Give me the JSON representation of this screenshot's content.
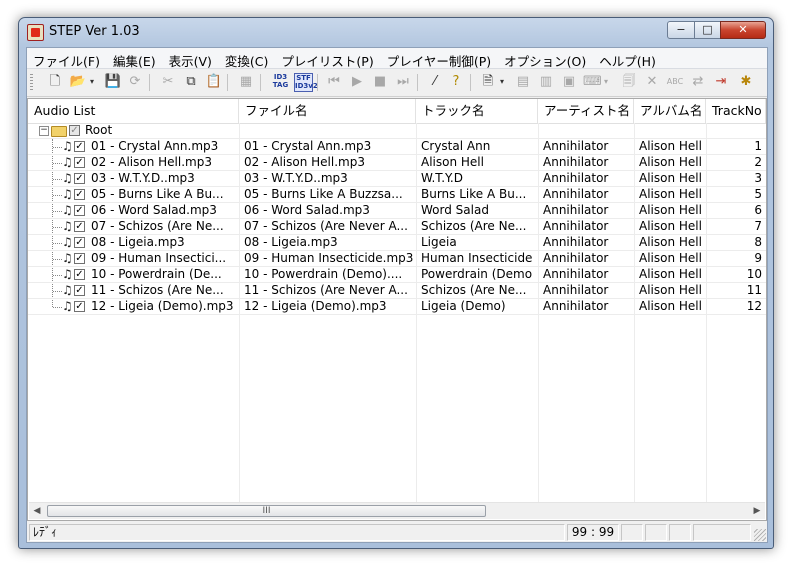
{
  "window": {
    "title": "STEP Ver 1.03",
    "caption": {
      "minimize": "−",
      "maximize": "□",
      "close": "✕"
    }
  },
  "menu": [
    "ファイル(F)",
    "編集(E)",
    "表示(V)",
    "変換(C)",
    "プレイリスト(P)",
    "プレイヤー制御(P)",
    "オプション(O)",
    "ヘルプ(H)"
  ],
  "toolbar": {
    "new_icon": "new-file-icon",
    "open_icon": "open-folder-icon",
    "save_icon": "save-icon",
    "id3_tag_label_top": "ID3",
    "id3_tag_label_bottom": "TAG",
    "stf_label_top": "STF",
    "stf_label_bottom": "ID3v2"
  },
  "columns": [
    "Audio List",
    "ファイル名",
    "トラック名",
    "アーティスト名",
    "アルバム名",
    "TrackNo"
  ],
  "root": {
    "label": "Root"
  },
  "rows": [
    {
      "audio": "01 - Crystal Ann.mp3",
      "file": "01 - Crystal Ann.mp3",
      "track": "Crystal Ann",
      "artist": "Annihilator",
      "album": "Alison Hell",
      "no": "1"
    },
    {
      "audio": "02 - Alison Hell.mp3",
      "file": "02 - Alison Hell.mp3",
      "track": "Alison Hell",
      "artist": "Annihilator",
      "album": "Alison Hell",
      "no": "2"
    },
    {
      "audio": "03 - W.T.Y.D..mp3",
      "file": "03 - W.T.Y.D..mp3",
      "track": "W.T.Y.D",
      "artist": "Annihilator",
      "album": "Alison Hell",
      "no": "3"
    },
    {
      "audio": "05 - Burns Like A Bu...",
      "file": "05 - Burns Like A Buzzsa...",
      "track": "Burns Like A Bu...",
      "artist": "Annihilator",
      "album": "Alison Hell",
      "no": "5"
    },
    {
      "audio": "06 - Word Salad.mp3",
      "file": "06 - Word Salad.mp3",
      "track": "Word Salad",
      "artist": "Annihilator",
      "album": "Alison Hell",
      "no": "6"
    },
    {
      "audio": "07 - Schizos (Are Ne...",
      "file": "07 - Schizos (Are Never A...",
      "track": "Schizos (Are Ne...",
      "artist": "Annihilator",
      "album": "Alison Hell",
      "no": "7"
    },
    {
      "audio": "08 - Ligeia.mp3",
      "file": "08 - Ligeia.mp3",
      "track": "Ligeia",
      "artist": "Annihilator",
      "album": "Alison Hell",
      "no": "8"
    },
    {
      "audio": "09 - Human Insectici...",
      "file": "09 - Human Insecticide.mp3",
      "track": "Human Insecticide",
      "artist": "Annihilator",
      "album": "Alison Hell",
      "no": "9"
    },
    {
      "audio": "10 - Powerdrain (De...",
      "file": "10 - Powerdrain (Demo)....",
      "track": "Powerdrain (Demo",
      "artist": "Annihilator",
      "album": "Alison Hell",
      "no": "10"
    },
    {
      "audio": "11 - Schizos (Are Ne...",
      "file": "11 - Schizos (Are Never A...",
      "track": "Schizos (Are Ne...",
      "artist": "Annihilator",
      "album": "Alison Hell",
      "no": "11"
    },
    {
      "audio": "12 - Ligeia (Demo).mp3",
      "file": "12 - Ligeia (Demo).mp3",
      "track": "Ligeia (Demo)",
      "artist": "Annihilator",
      "album": "Alison Hell",
      "no": "12"
    }
  ],
  "scrollbar": {
    "left": "◀",
    "right": "▶",
    "grip": "III"
  },
  "status": {
    "text": "ﾚﾃﾞｨ",
    "position": "99 : 99"
  }
}
